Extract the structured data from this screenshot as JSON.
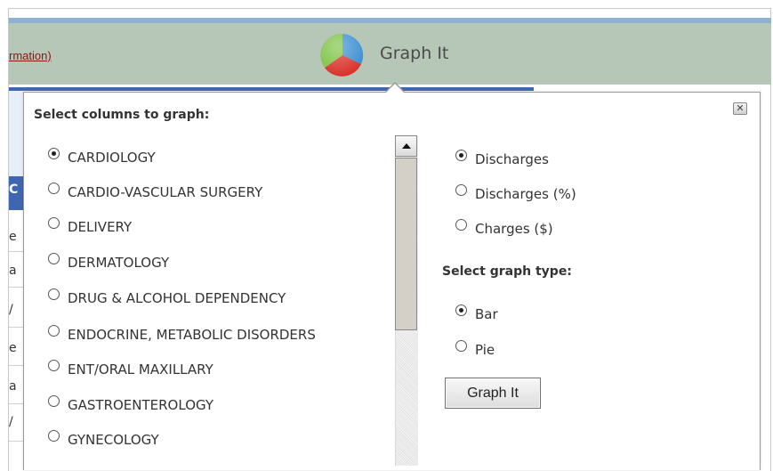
{
  "header": {
    "link_text": "rmation)",
    "title": "Graph It",
    "icon": "pie-chart-icon"
  },
  "background": {
    "left_letters": [
      "C",
      "e",
      "a",
      "/",
      "e",
      "a",
      "/"
    ]
  },
  "popup": {
    "columns_title": "Select columns to graph:",
    "columns": [
      {
        "label": "CARDIOLOGY",
        "selected": true
      },
      {
        "label": "CARDIO-VASCULAR SURGERY",
        "selected": false
      },
      {
        "label": "DELIVERY",
        "selected": false
      },
      {
        "label": "DERMATOLOGY",
        "selected": false
      },
      {
        "label": "DRUG & ALCOHOL DEPENDENCY",
        "selected": false
      },
      {
        "label": "ENDOCRINE, METABOLIC DISORDERS",
        "selected": false
      },
      {
        "label": "ENT/ORAL MAXILLARY",
        "selected": false
      },
      {
        "label": "GASTROENTEROLOGY",
        "selected": false
      },
      {
        "label": "GYNECOLOGY",
        "selected": false
      }
    ],
    "measures": [
      {
        "label": "Discharges",
        "selected": true
      },
      {
        "label": "Discharges (%)",
        "selected": false
      },
      {
        "label": "Charges ($)",
        "selected": false
      }
    ],
    "graph_type_title": "Select graph type:",
    "graph_types": [
      {
        "label": "Bar",
        "selected": true
      },
      {
        "label": "Pie",
        "selected": false
      }
    ],
    "button_label": "Graph It",
    "close_label": "✕"
  },
  "colors": {
    "header_bg": "#b7c7b7",
    "top_strip": "#8fb0cf",
    "link": "#8b1414"
  }
}
